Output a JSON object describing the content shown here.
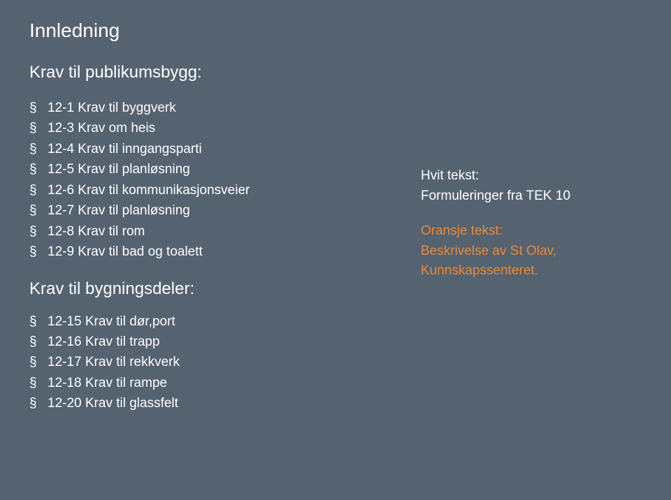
{
  "title": "Innledning",
  "section1": {
    "heading": "Krav til publikumsbygg:",
    "items": [
      "12-1 Krav til byggverk",
      "12-3 Krav om heis",
      "12-4 Krav til inngangsparti",
      "12-5 Krav til planløsning",
      "12-6 Krav til kommunikasjonsveier",
      "12-7 Krav til planløsning",
      "12-8 Krav til rom",
      "12-9 Krav til bad og toalett"
    ]
  },
  "section2": {
    "heading": "Krav til bygningsdeler:",
    "items": [
      "12-15 Krav til dør,port",
      "12-16 Krav til trapp",
      "12-17 Krav til rekkverk",
      "12-18 Krav til rampe",
      "12-20 Krav til glassfelt"
    ]
  },
  "legend": {
    "white": "Hvit tekst:\nFormuleringer fra TEK 10",
    "orange": "Oransje tekst:\nBeskrivelse av  St Olav, Kunnskapssenteret."
  }
}
